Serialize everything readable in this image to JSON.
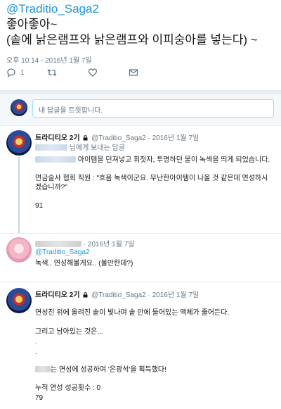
{
  "tweet": {
    "handle": "@Traditio_Saga2",
    "text_line1": "좋아좋아~",
    "text_line2": "(솥에 낡은램프와 낡은램프와 이피숭아를 넣는다) ~",
    "meta": "오후 10:14 - 2016년 1월 7일",
    "reply_count": "1"
  },
  "reply_box": {
    "placeholder": "내 답글을 트윗합니다."
  },
  "replies": [
    {
      "name": "트라디티오 2기",
      "handle_time": "@Traditio_Saga2 · 2016년 1월 7일",
      "replying_to_suffix": "님에게 보내는 답글",
      "line1_suffix": "아이템을 던져넣고 휘젓자, 투명하던 물이 녹색을 띄게 되었습니다.",
      "line2": "연금술사 협회 직원 : \"흐음 녹색이군요. 무난한아이템이 나올 것 같은데 연성하시겠습니까?\"",
      "line3": "91"
    },
    {
      "time": "· 2016년 1월 7일",
      "mention": "@Traditio_Saga2",
      "line1": "녹색.. 연성해볼게요.. (불안한데?)"
    },
    {
      "name": "트라디티오 2기",
      "handle_time": "@Traditio_Saga2 · 2016년 1월 7일",
      "line1": "연성진 위에 올려진 솥이 빛나며 솥 만에 들어있는 액체가 줄어든다.",
      "line2": "그리고 남아있는 것은...",
      "dot": ".",
      "line3_suffix": "는 연성에 성공하여 '은광석'을 획득했다!",
      "line4": "누적 연성 성공횟수 : 0",
      "line5": "79"
    }
  ]
}
